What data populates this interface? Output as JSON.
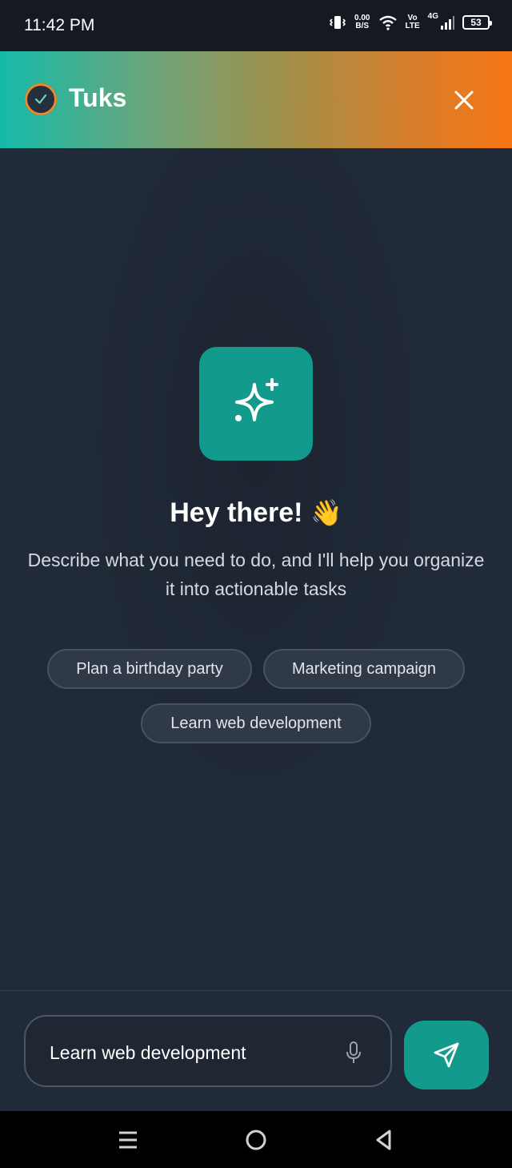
{
  "status_bar": {
    "time": "11:42 PM",
    "net_speed_value": "0.00",
    "net_speed_unit": "B/S",
    "volte_top": "Vo",
    "volte_bottom": "LTE",
    "network_type": "4G",
    "battery": "53"
  },
  "header": {
    "title": "Tuks",
    "logo_icon": "check-circle-icon",
    "close_icon": "close-icon"
  },
  "main": {
    "hero_icon": "sparkles-icon",
    "greeting": "Hey there!",
    "greeting_emoji": "👋",
    "subtitle": "Describe what you need to do, and I'll help you organize it into actionable tasks",
    "suggestions": [
      "Plan a birthday party",
      "Marketing campaign",
      "Learn web development"
    ]
  },
  "composer": {
    "input_value": "Learn web development",
    "mic_icon": "microphone-icon",
    "send_icon": "send-icon"
  },
  "colors": {
    "accent": "#129a8d",
    "background": "#212a38",
    "header_gradient_start": "#14bba9",
    "header_gradient_end": "#f77614"
  }
}
